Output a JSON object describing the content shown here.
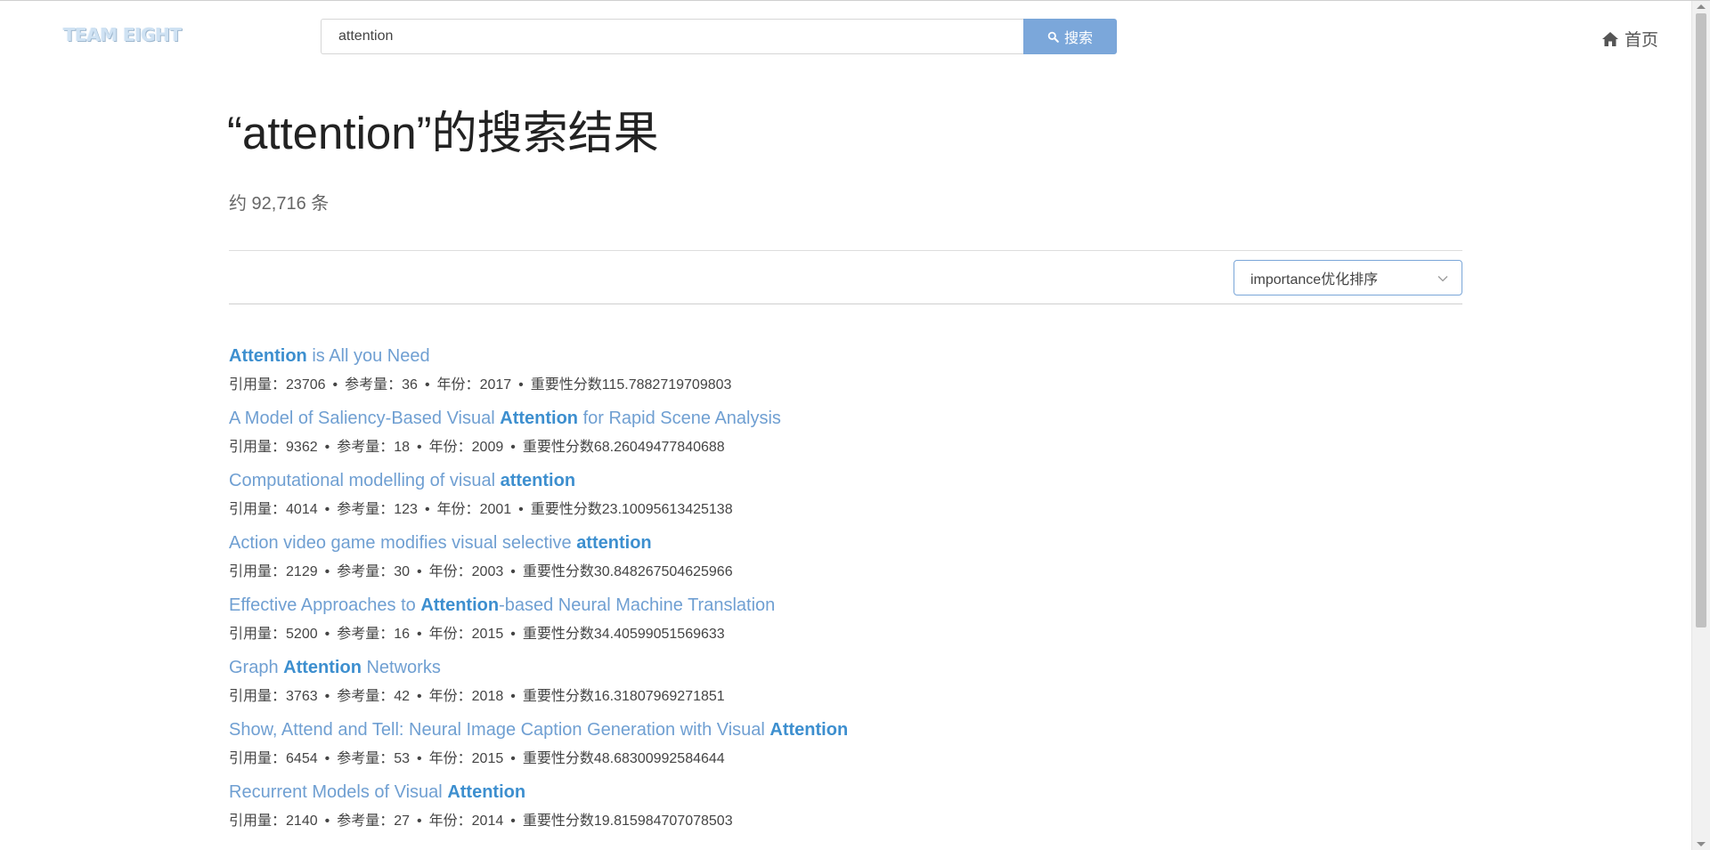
{
  "brand": "TEAM EIGHT",
  "search": {
    "value": "attention",
    "button_label": "搜索"
  },
  "nav": {
    "home_label": "首页"
  },
  "title": "“attention”的搜索结果",
  "count_text": "约 92,716 条",
  "sort": {
    "selected": "importance优化排序"
  },
  "colors": {
    "accent": "#7ba7da",
    "title_link": "#6f9fd2",
    "highlight": "#3d8fcf"
  },
  "results": [
    {
      "title_parts": [
        {
          "t": "Attention",
          "hl": true
        },
        {
          "t": " is All you Need",
          "hl": false
        }
      ],
      "citations": "23706",
      "references": "36",
      "year": "2017",
      "score": "115.7882719709803"
    },
    {
      "title_parts": [
        {
          "t": "A Model of Saliency-Based Visual ",
          "hl": false
        },
        {
          "t": "Attention",
          "hl": true
        },
        {
          "t": " for Rapid Scene Analysis",
          "hl": false
        }
      ],
      "citations": "9362",
      "references": "18",
      "year": "2009",
      "score": "68.26049477840688"
    },
    {
      "title_parts": [
        {
          "t": "Computational modelling of visual ",
          "hl": false
        },
        {
          "t": "attention",
          "hl": true
        }
      ],
      "citations": "4014",
      "references": "123",
      "year": "2001",
      "score": "23.10095613425138"
    },
    {
      "title_parts": [
        {
          "t": "Action video game modifies visual selective ",
          "hl": false
        },
        {
          "t": "attention",
          "hl": true
        }
      ],
      "citations": "2129",
      "references": "30",
      "year": "2003",
      "score": "30.848267504625966"
    },
    {
      "title_parts": [
        {
          "t": "Effective Approaches to ",
          "hl": false
        },
        {
          "t": "Attention",
          "hl": true
        },
        {
          "t": "-based Neural Machine Translation",
          "hl": false
        }
      ],
      "citations": "5200",
      "references": "16",
      "year": "2015",
      "score": "34.40599051569633"
    },
    {
      "title_parts": [
        {
          "t": "Graph ",
          "hl": false
        },
        {
          "t": "Attention",
          "hl": true
        },
        {
          "t": " Networks",
          "hl": false
        }
      ],
      "citations": "3763",
      "references": "42",
      "year": "2018",
      "score": "16.31807969271851"
    },
    {
      "title_parts": [
        {
          "t": "Show, Attend and Tell: Neural Image Caption Generation with Visual ",
          "hl": false
        },
        {
          "t": "Attention",
          "hl": true
        }
      ],
      "citations": "6454",
      "references": "53",
      "year": "2015",
      "score": "48.68300992584644"
    },
    {
      "title_parts": [
        {
          "t": "Recurrent Models of Visual ",
          "hl": false
        },
        {
          "t": "Attention",
          "hl": true
        }
      ],
      "citations": "2140",
      "references": "27",
      "year": "2014",
      "score": "19.815984707078503"
    }
  ],
  "meta_labels": {
    "citations": "引用量：",
    "references": "参考量：",
    "year": "年份：",
    "score": "重要性分数",
    "sep": "•"
  }
}
